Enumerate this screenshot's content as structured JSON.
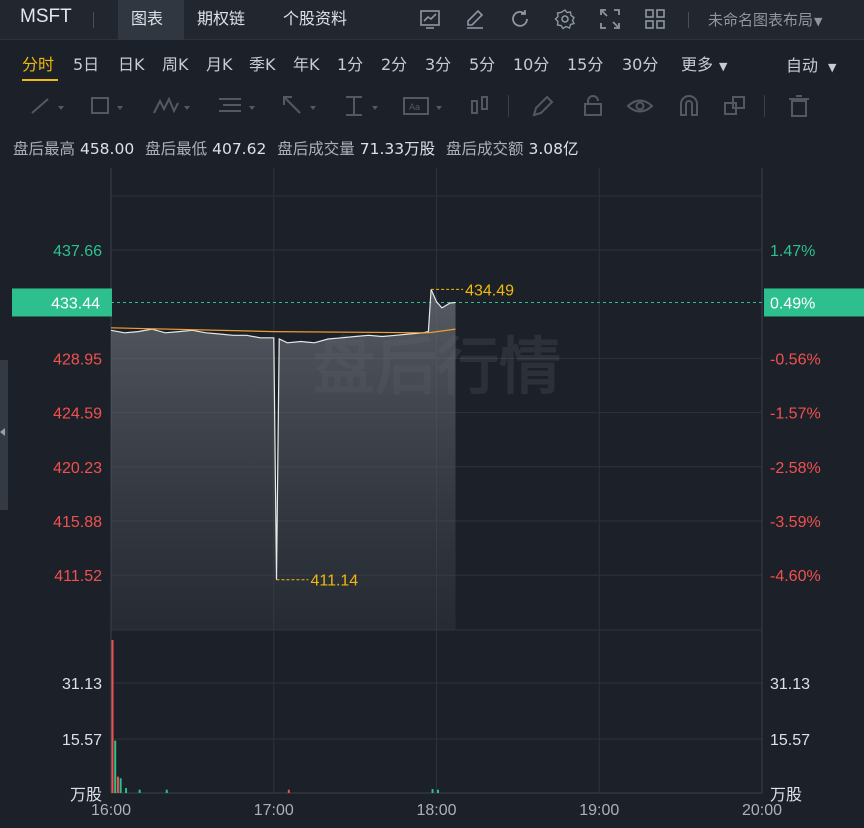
{
  "ticker": "MSFT",
  "top_tabs": [
    "图表",
    "期权链",
    "个股资料"
  ],
  "layout_label": "未命名图表布局",
  "periods": [
    "分时",
    "5日",
    "日K",
    "周K",
    "月K",
    "季K",
    "年K",
    "1分",
    "2分",
    "3分",
    "5分",
    "10分",
    "15分",
    "30分",
    "更多"
  ],
  "active_period": "分时",
  "auto_label": "自动",
  "toolbar_icons": [
    "chart-type-icon",
    "draw-icon",
    "refresh-icon",
    "settings-icon",
    "fullscreen-icon",
    "grid-layout-icon"
  ],
  "stats": {
    "high_label": "盘后最高",
    "high": "458.00",
    "low_label": "盘后最低",
    "low": "407.62",
    "vol_label": "盘后成交量",
    "vol": "71.33万股",
    "amt_label": "盘后成交额",
    "amt": "3.08亿"
  },
  "watermark": "盘后行情",
  "colors": {
    "up": "#2dc08e",
    "down": "#f0514e",
    "accent": "#f0b90b",
    "avg_line": "#f0a030",
    "price_line": "#e8e8e8"
  },
  "chart_data": {
    "type": "line",
    "x_ticks": [
      "16:00",
      "17:00",
      "18:00",
      "19:00",
      "20:00"
    ],
    "price_ticks_left": [
      "437.66",
      "433.44",
      "428.95",
      "424.59",
      "420.23",
      "415.88",
      "411.52"
    ],
    "pct_ticks_right": [
      "1.47%",
      "0.49%",
      "-0.56%",
      "-1.57%",
      "-2.58%",
      "-3.59%",
      "-4.60%"
    ],
    "current_price": "433.44",
    "current_pct": "0.49%",
    "ylim": [
      409.4,
      440.3
    ],
    "price_series": {
      "x": [
        "16:00",
        "16:05",
        "16:10",
        "16:15",
        "16:20",
        "16:25",
        "16:30",
        "16:35",
        "16:40",
        "16:45",
        "16:50",
        "16:55",
        "17:00",
        "17:01",
        "17:02",
        "17:05",
        "17:10",
        "17:15",
        "17:20",
        "17:25",
        "17:30",
        "17:35",
        "17:40",
        "17:45",
        "17:50",
        "17:55",
        "17:57",
        "17:58",
        "18:00",
        "18:02",
        "18:05",
        "18:07"
      ],
      "y": [
        431.2,
        431.0,
        431.1,
        431.3,
        431.0,
        431.1,
        431.2,
        431.0,
        430.9,
        430.8,
        430.8,
        430.6,
        430.6,
        411.14,
        430.5,
        430.2,
        430.3,
        430.2,
        430.5,
        430.6,
        430.7,
        430.8,
        430.7,
        430.8,
        430.9,
        431.0,
        431.1,
        434.49,
        433.5,
        433.0,
        433.4,
        433.44
      ]
    },
    "avg_series": {
      "x": [
        "16:00",
        "17:00",
        "17:57",
        "18:07"
      ],
      "y": [
        431.4,
        431.1,
        431.0,
        431.3
      ]
    },
    "annotations": [
      {
        "x": "17:01",
        "y": 411.14,
        "label": "411.14"
      },
      {
        "x": "17:58",
        "y": 434.49,
        "label": "434.49"
      }
    ],
    "volume": {
      "unit": "万股",
      "ticks": [
        "31.13",
        "15.57"
      ],
      "ylim": [
        0,
        46.7
      ],
      "bars": [
        {
          "x": "16:00",
          "v": 46.7,
          "dir": "down"
        },
        {
          "x": "16:01",
          "v": 16.0,
          "dir": "up"
        },
        {
          "x": "16:02",
          "v": 5.0,
          "dir": "down"
        },
        {
          "x": "16:03",
          "v": 4.5,
          "dir": "up"
        },
        {
          "x": "16:05",
          "v": 1.5,
          "dir": "up"
        },
        {
          "x": "16:10",
          "v": 1.0,
          "dir": "up"
        },
        {
          "x": "16:20",
          "v": 1.0,
          "dir": "up"
        },
        {
          "x": "17:05",
          "v": 1.0,
          "dir": "down"
        },
        {
          "x": "17:58",
          "v": 1.2,
          "dir": "up"
        },
        {
          "x": "18:00",
          "v": 1.0,
          "dir": "up"
        }
      ]
    }
  }
}
